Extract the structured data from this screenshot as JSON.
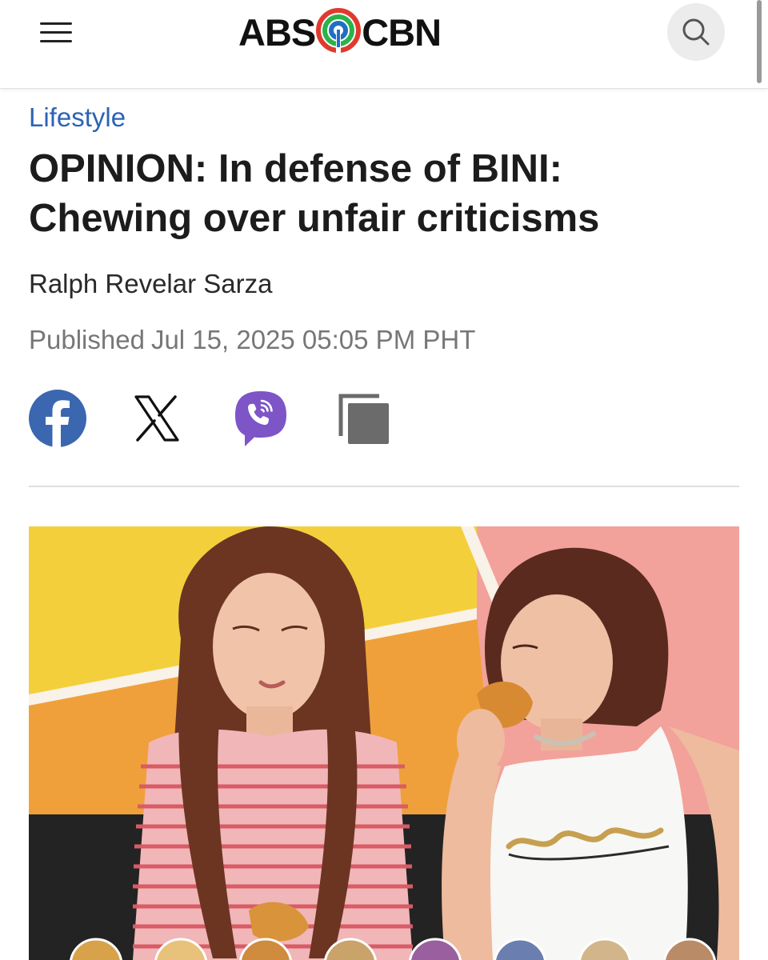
{
  "header": {
    "menu_icon": "hamburger-menu-icon",
    "logo": {
      "left": "ABS",
      "right": "CBN"
    },
    "search_icon": "search-icon"
  },
  "article": {
    "category": "Lifestyle",
    "headline_line1": "OPINION: In defense of BINI:",
    "headline_line2": "Chewing over unfair criticisms",
    "author": "Ralph Revelar Sarza",
    "published_label": "Published",
    "published_date": "Jul 15, 2025 05:05 PM PHT"
  },
  "share": [
    {
      "name": "facebook-share",
      "icon": "facebook-icon",
      "color": "#3b67b1"
    },
    {
      "name": "x-share",
      "icon": "x-icon",
      "color": "#111111"
    },
    {
      "name": "viber-share",
      "icon": "viber-icon",
      "color": "#7d55c7"
    },
    {
      "name": "copy-link",
      "icon": "copy-icon",
      "color": "#6b6b6b"
    }
  ],
  "colors": {
    "accent": "#2b63b5",
    "text": "#1c1c1c",
    "muted": "#777777"
  }
}
